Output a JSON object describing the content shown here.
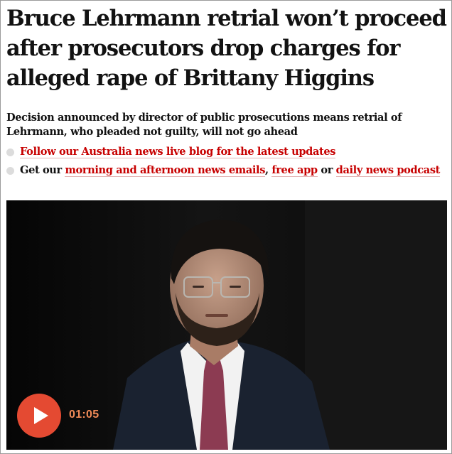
{
  "article": {
    "headline": "Bruce Lehrmann retrial won’t proceed after prosecutors drop charges for alleged rape of Brittany Higgins",
    "standfirst": "Decision announced by director of public prosecutions means retrial of Lehrmann, who pleaded not guilty, will not go ahead",
    "bullets": {
      "first": {
        "link": "Follow our Australia news live blog for the latest updates"
      },
      "second": {
        "prefix": "Get our ",
        "link_emails": "morning and afternoon news emails",
        "sep": ", ",
        "link_app": "free app",
        "or": " or ",
        "link_podcast": "daily news podcast"
      }
    }
  },
  "media": {
    "duration": "01:05",
    "play_icon": "play-icon",
    "colors": {
      "play_button": "#e44a32",
      "duration_text": "#f08a57",
      "link": "#c70000"
    }
  }
}
